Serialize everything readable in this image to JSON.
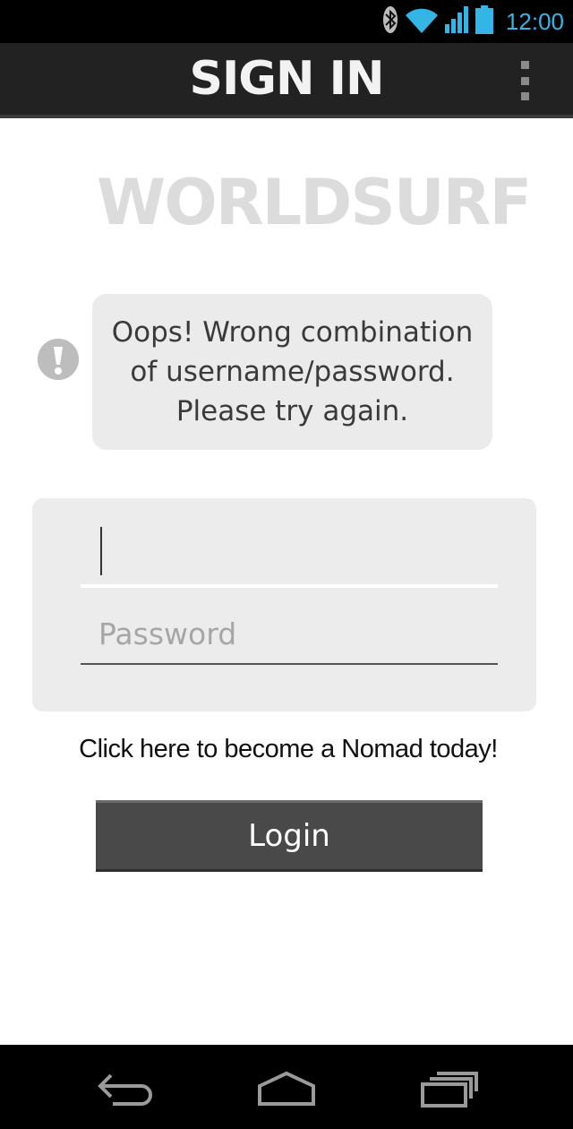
{
  "status_bar": {
    "time": "12:00",
    "icons": [
      "bluetooth-icon",
      "wifi-icon",
      "signal-icon",
      "battery-icon"
    ],
    "accent_color": "#33b5e5"
  },
  "action_bar": {
    "title": "SIGN IN",
    "menu_icon": "overflow-menu-icon"
  },
  "logo": {
    "text": "WORLDSURF",
    "color": "#dcdcdc"
  },
  "alert": {
    "icon": "exclamation-icon",
    "message": "Oops! Wrong combination\nof username/password.\nPlease try again."
  },
  "form": {
    "username": {
      "value": "",
      "placeholder": ""
    },
    "password": {
      "value": "",
      "placeholder": "Password"
    }
  },
  "signup_link": "Click here to become a Nomad today!",
  "login_button": {
    "label": "Login",
    "color": "#494949"
  },
  "nav_bar": {
    "buttons": [
      "back-icon",
      "home-icon",
      "recent-apps-icon"
    ]
  }
}
